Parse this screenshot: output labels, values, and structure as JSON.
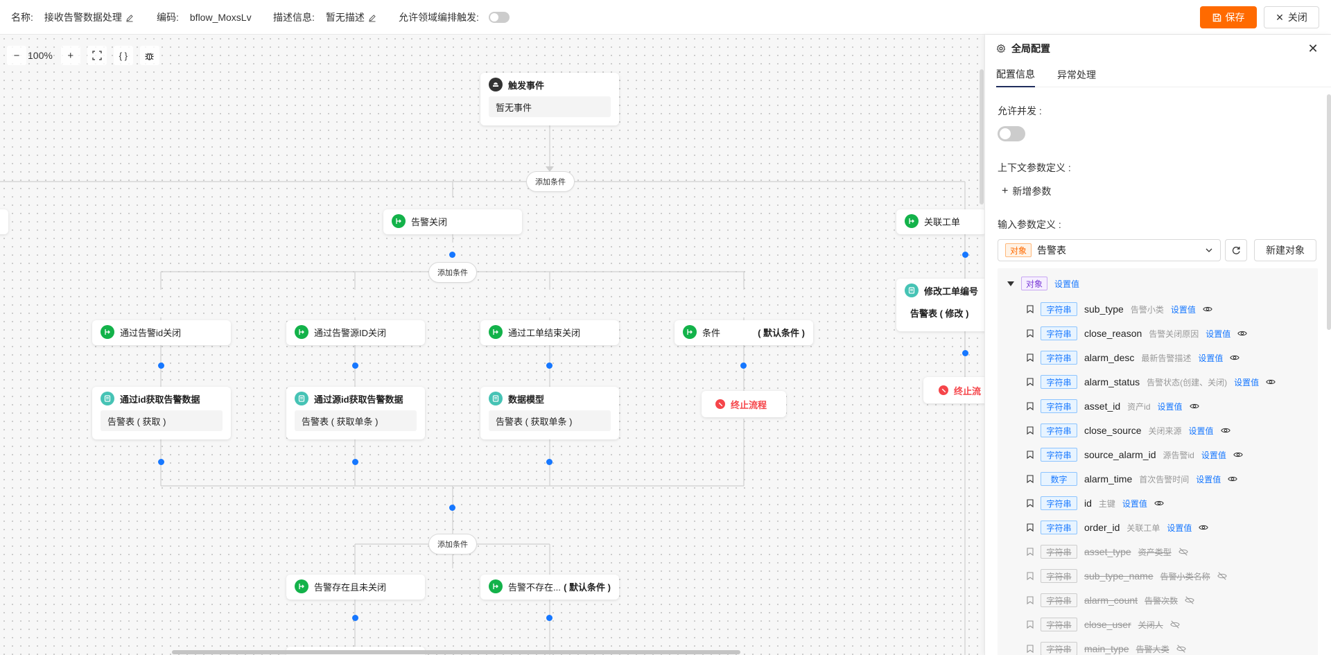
{
  "header": {
    "name_label": "名称:",
    "name_value": "接收告警数据处理",
    "code_label": "编码:",
    "code_value": "bflow_MoxsLv",
    "desc_label": "描述信息:",
    "desc_value": "暂无描述",
    "cross_label": "允许领域编排触发:",
    "save_label": "保存",
    "close_label": "关闭"
  },
  "toolbar": {
    "zoom": "100%",
    "minus": "−",
    "plus": "+",
    "braces": "{ }"
  },
  "flow": {
    "trigger": {
      "title": "触发事件",
      "body": "暂无事件"
    },
    "add_condition": "添加条件",
    "branch_alarm_close": "告警关闭",
    "branch_related_order": "关联工单",
    "cond_by_alarm_id": "通过告警id关闭",
    "cond_by_source_id": "通过告警源ID关闭",
    "cond_by_order_end": "通过工单结束关闭",
    "cond_default_label": "条件",
    "default_tag": "( 默认条件 )",
    "data_get_by_id": {
      "title": "通过id获取告警数据",
      "body": "告警表 ( 获取 )"
    },
    "data_get_by_source": {
      "title": "通过源id获取告警数据",
      "body": "告警表 ( 获取单条 )"
    },
    "data_model": {
      "title": "数据模型",
      "body": "告警表 ( 获取单条 )"
    },
    "stop_flow": "终止流程",
    "stop_flow_partial": "终止流",
    "modify_order": {
      "title": "修改工单编号",
      "body": "告警表 ( 修改 )"
    },
    "cond_exists_not_closed": "告警存在且未关闭",
    "cond_not_exists": "告警不存在...",
    "default_tag_2": "( 默认条件 )"
  },
  "panel": {
    "title": "全局配置",
    "tabs": [
      "配置信息",
      "异常处理"
    ],
    "allow_concurrent": "允许并发 :",
    "context_params": "上下文参数定义 :",
    "add_param": "新增参数",
    "input_params": "输入参数定义 :",
    "selected_tag": "对象",
    "selected_value": "告警表",
    "new_object": "新建对象",
    "root_tag": "对象",
    "set_value": "设置值",
    "fields": [
      {
        "type": "字符串",
        "name": "sub_type",
        "desc": "告警小类",
        "enabled": true
      },
      {
        "type": "字符串",
        "name": "close_reason",
        "desc": "告警关闭原因",
        "enabled": true
      },
      {
        "type": "字符串",
        "name": "alarm_desc",
        "desc": "最新告警描述",
        "enabled": true
      },
      {
        "type": "字符串",
        "name": "alarm_status",
        "desc": "告警状态(创建、关闭)",
        "enabled": true
      },
      {
        "type": "字符串",
        "name": "asset_id",
        "desc": "资产id",
        "enabled": true
      },
      {
        "type": "字符串",
        "name": "close_source",
        "desc": "关闭来源",
        "enabled": true
      },
      {
        "type": "字符串",
        "name": "source_alarm_id",
        "desc": "源告警id",
        "enabled": true
      },
      {
        "type": "数字",
        "name": "alarm_time",
        "desc": "首次告警时间",
        "enabled": true
      },
      {
        "type": "字符串",
        "name": "id",
        "desc": "主键",
        "enabled": true
      },
      {
        "type": "字符串",
        "name": "order_id",
        "desc": "关联工单",
        "enabled": true
      },
      {
        "type": "字符串",
        "name": "asset_type",
        "desc": "资产类型",
        "enabled": false
      },
      {
        "type": "字符串",
        "name": "sub_type_name",
        "desc": "告警小类名称",
        "enabled": false
      },
      {
        "type": "字符串",
        "name": "alarm_count",
        "desc": "告警次数",
        "enabled": false
      },
      {
        "type": "字符串",
        "name": "close_user",
        "desc": "关闭人",
        "enabled": false
      },
      {
        "type": "字符串",
        "name": "main_type",
        "desc": "告警大类",
        "enabled": false
      }
    ]
  }
}
